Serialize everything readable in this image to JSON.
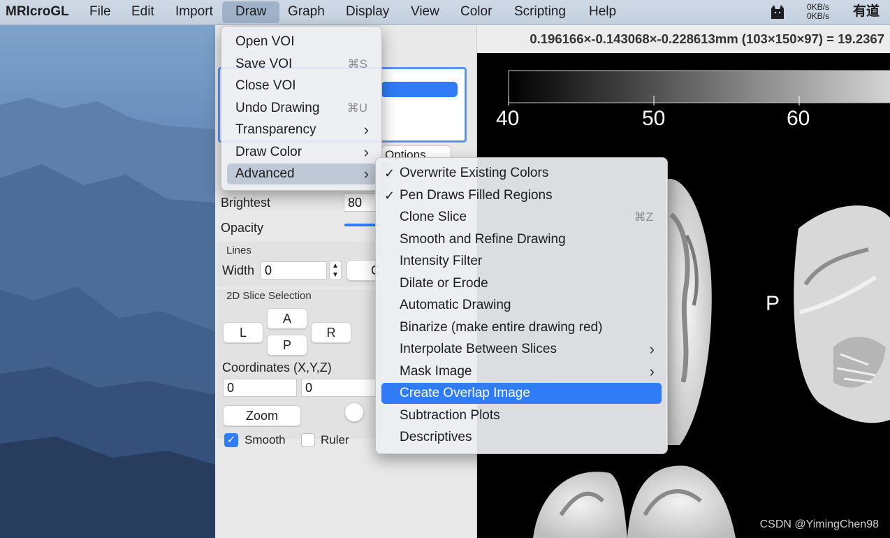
{
  "menubar": {
    "app_name": "MRIcroGL",
    "items": [
      "File",
      "Edit",
      "Import",
      "Draw",
      "Graph",
      "Display",
      "View",
      "Color",
      "Scripting",
      "Help"
    ],
    "net_up": "0KB/s",
    "net_down": "0KB/s",
    "dict_app": "有道"
  },
  "status": {
    "text": "0.196166×-0.143068×-0.228613mm (103×150×97) =  19.2367"
  },
  "panel": {
    "options_label": "Options",
    "brightest_label": "Brightest",
    "brightest_value": "80",
    "opacity_label": "Opacity",
    "lines_label": "Lines",
    "width_label": "Width",
    "width_value": "0",
    "c_button": "C",
    "slice_section": "2D Slice Selection",
    "btn_l": "L",
    "btn_a": "A",
    "btn_r": "R",
    "btn_p": "P",
    "coords_label": "Coordinates (X,Y,Z)",
    "coord_x": "0",
    "coord_y": "0",
    "zoom_label": "Zoom",
    "smooth_label": "Smooth",
    "smooth_checked": true,
    "ruler_label": "Ruler",
    "ruler_checked": false
  },
  "draw_menu": {
    "items": [
      {
        "label": "Open VOI",
        "shortcut": ""
      },
      {
        "label": "Save VOI",
        "shortcut": "⌘S"
      },
      {
        "label": "Close VOI",
        "shortcut": ""
      },
      {
        "label": "Undo Drawing",
        "shortcut": "⌘U"
      },
      {
        "label": "Transparency",
        "submenu": true
      },
      {
        "label": "Draw Color",
        "submenu": true
      },
      {
        "label": "Advanced",
        "submenu": true
      }
    ]
  },
  "advanced_menu": {
    "items": [
      {
        "label": "Overwrite Existing Colors",
        "checked": true
      },
      {
        "label": "Pen Draws Filled Regions",
        "checked": true
      },
      {
        "label": "Clone Slice",
        "shortcut": "⌘Z"
      },
      {
        "label": "Smooth and Refine Drawing"
      },
      {
        "label": "Intensity Filter"
      },
      {
        "label": "Dilate or Erode"
      },
      {
        "label": "Automatic Drawing"
      },
      {
        "label": "Binarize (make entire drawing red)"
      },
      {
        "label": "Interpolate Between Slices",
        "submenu": true
      },
      {
        "label": "Mask Image",
        "submenu": true
      },
      {
        "label": "Create Overlap Image",
        "selected": true
      },
      {
        "label": "Subtraction Plots"
      },
      {
        "label": "Descriptives"
      }
    ]
  },
  "viewer": {
    "colorbar_ticks": [
      "40",
      "50",
      "60"
    ],
    "orientation_label": "P"
  },
  "watermark": "CSDN @YimingChen98",
  "colors": {
    "accent": "#2f7cf6",
    "menu_highlight": "#bfc8d6"
  }
}
